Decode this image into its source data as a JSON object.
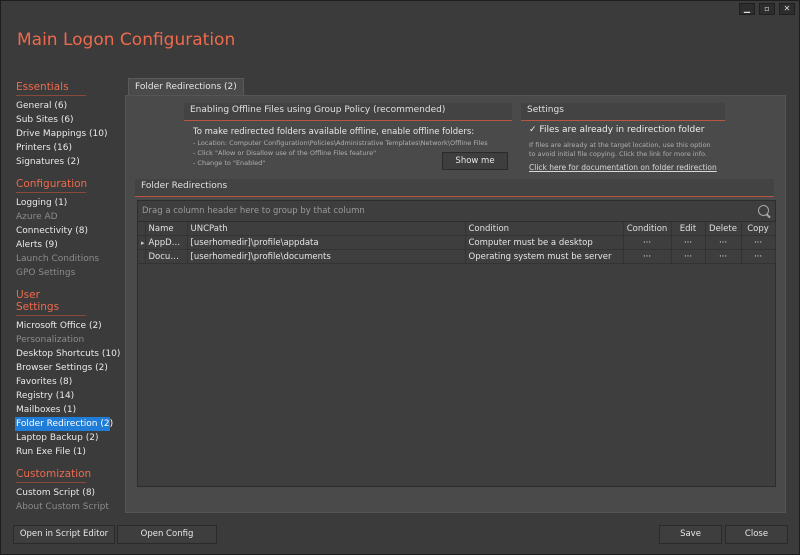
{
  "app": {
    "title": "Main Logon Configuration"
  },
  "window": {
    "min": "▁",
    "restore": "▫",
    "close": "✕"
  },
  "nav": {
    "essentials": {
      "title": "Essentials",
      "items": [
        "General (6)",
        "Sub Sites (6)",
        "Drive Mappings (10)",
        "Printers (16)",
        "Signatures (2)"
      ]
    },
    "configuration": {
      "title": "Configuration",
      "items": [
        "Logging (1)",
        "Azure AD",
        "Connectivity (8)",
        "Alerts (9)",
        "Launch Conditions",
        "GPO Settings"
      ]
    },
    "user_settings": {
      "title": "User Settings",
      "items": [
        "Microsoft Office (2)",
        "Personalization",
        "Desktop Shortcuts (10)",
        "Browser Settings (2)",
        "Favorites (8)",
        "Registry (14)",
        "Mailboxes (1)",
        "Folder Redirection (2)",
        "Laptop Backup (2)",
        "Run Exe File (1)"
      ]
    },
    "customization": {
      "title": "Customization",
      "items": [
        "Custom Script (8)",
        "About Custom Script"
      ]
    }
  },
  "tab": {
    "label": "Folder Redirections (2)"
  },
  "offline": {
    "header": "Enabling Offline Files using Group Policy (recommended)",
    "intro": "To make redirected folders available offline, enable offline folders:",
    "line1": "- Location: Computer Configuration\\Policies\\Administrative Templates\\Network\\Offline Files",
    "line2": "- Click \"Allow or Disallow use of the Offline Files feature\"",
    "line3": "- Change to \"Enabled\"",
    "button": "Show me"
  },
  "settings": {
    "header": "Settings",
    "checkbox_label": "Files are already in redirection folder",
    "checked": "✓",
    "help1": "If files are already at the target location, use this option",
    "help2": "to avoid initial file copying. Click the link for more info.",
    "link": "Click here for documentation on folder redirection"
  },
  "grid": {
    "header": "Folder Redirections",
    "group_hint": "Drag a column header here to group by that column",
    "columns": [
      "Name",
      "UNCPath",
      "Condition",
      "Condition",
      "Edit",
      "Delete",
      "Copy"
    ],
    "rows": [
      {
        "indicator": "▸",
        "name": "AppData",
        "unc": "[userhomedir]\\profile\\appdata",
        "condition": "Computer must be a desktop",
        "cond_btn": "···",
        "edit": "···",
        "delete": "···",
        "copy": "···"
      },
      {
        "indicator": "",
        "name": "Documents",
        "unc": "[userhomedir]\\profile\\documents",
        "condition": "Operating system must be server",
        "cond_btn": "···",
        "edit": "···",
        "delete": "···",
        "copy": "···"
      }
    ]
  },
  "footer": {
    "script_editor": "Open in Script Editor",
    "open_config": "Open Config",
    "save": "Save",
    "close": "Close"
  }
}
